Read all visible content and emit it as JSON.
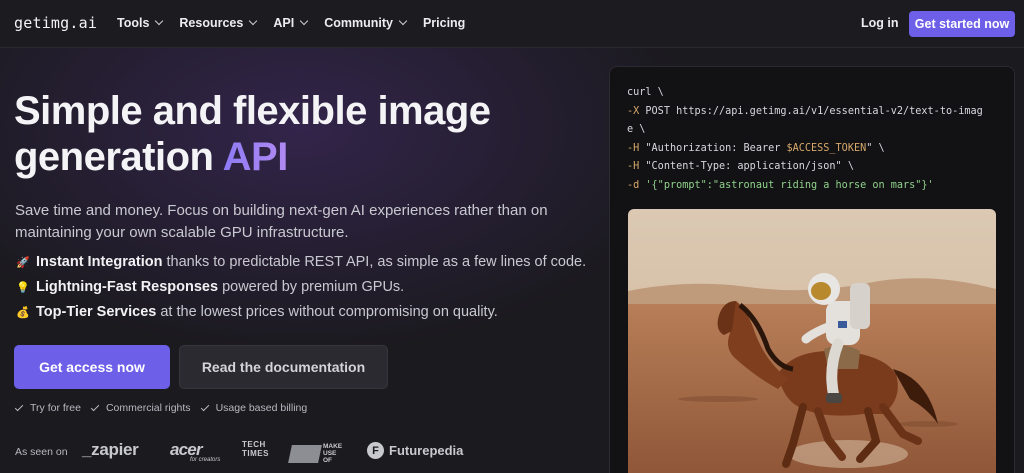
{
  "nav": {
    "logo": "getimg.ai",
    "items": [
      {
        "label": "Tools",
        "dropdown": true
      },
      {
        "label": "Resources",
        "dropdown": true
      },
      {
        "label": "API",
        "dropdown": true
      },
      {
        "label": "Community",
        "dropdown": true
      },
      {
        "label": "Pricing",
        "dropdown": false
      }
    ],
    "login": "Log in",
    "cta": "Get started now"
  },
  "hero": {
    "title_main": "Simple and flexible image generation",
    "title_accent": "API",
    "subtitle": "Save time and money. Focus on building next-gen AI experiences rather than on maintaining your own scalable GPU infrastructure.",
    "features": [
      {
        "icon": "rocket-icon",
        "emoji": "🚀",
        "bold": "Instant Integration",
        "text": "thanks to predictable REST API, as simple as a few lines of code."
      },
      {
        "icon": "lightbulb-icon",
        "emoji": "💡",
        "bold": "Lightning-Fast Responses",
        "text": "powered by premium GPUs."
      },
      {
        "icon": "money-bag-icon",
        "emoji": "💰",
        "bold": "Top-Tier Services",
        "text": "at the lowest prices without compromising on quality."
      }
    ],
    "primary_button": "Get access now",
    "secondary_button": "Read the documentation",
    "perks": [
      "Try for free",
      "Commercial rights",
      "Usage based billing"
    ],
    "as_seen_on": "As seen on",
    "brands": {
      "zapier": "_zapier",
      "acer": "acer",
      "acer_tag": "for creators",
      "tech_times_1": "TECH",
      "tech_times_2": "TIMES",
      "muo_1": "MAKE",
      "muo_2": "USE",
      "muo_3": "OF",
      "futurepedia": "Futurepedia"
    }
  },
  "code": {
    "line1": "curl \\",
    "line2_flag": "-X",
    "line2_rest": " POST https://api.getimg.ai/v1/essential-v2/text-to-imag",
    "line3": "e \\",
    "line4_flag": "-H",
    "line4_str": " \"Authorization: Bearer ",
    "line4_var": "$ACCESS_TOKEN",
    "line4_end": "\" \\",
    "line5_flag": "-H",
    "line5_str": " \"Content-Type: application/json\"",
    "line5_end": " \\",
    "line6_flag": "-d",
    "line6_str": " '{\"prompt\":\"astronaut riding a horse on mars\"}'"
  },
  "colors": {
    "accent": "#6d5fe8",
    "background": "#1b1a1f",
    "code_green": "#8fd18a",
    "code_orange": "#d9a86a"
  }
}
